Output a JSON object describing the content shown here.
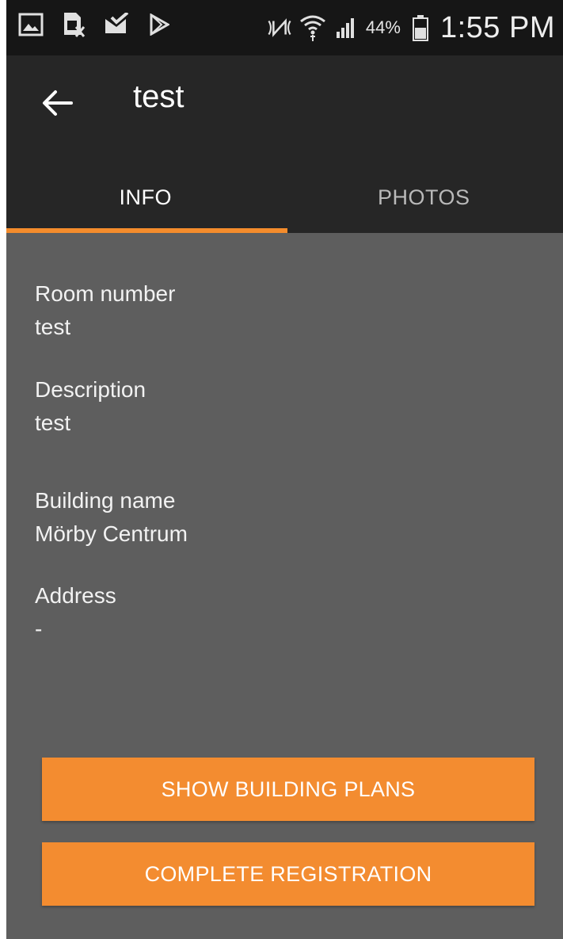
{
  "status_bar": {
    "left_icons": [
      "gallery-icon",
      "sim-card-icon",
      "check-mail-icon",
      "play-store-icon"
    ],
    "right_icons": [
      "nfc-icon",
      "wifi-icon",
      "signal-icon"
    ],
    "battery_percent": "44%",
    "time": "1:55 PM"
  },
  "app_bar": {
    "title": "test",
    "back_icon": "arrow-back-icon"
  },
  "tabs": [
    {
      "label": "INFO",
      "active": true
    },
    {
      "label": "PHOTOS",
      "active": false
    }
  ],
  "fields": [
    {
      "label": "Room number",
      "value": "test"
    },
    {
      "label": "Description",
      "value": "test"
    },
    {
      "label": "Building name",
      "value": "Mörby Centrum"
    },
    {
      "label": "Address",
      "value": "-"
    }
  ],
  "buttons": {
    "show_plans": "SHOW BUILDING PLANS",
    "complete": "COMPLETE REGISTRATION"
  },
  "colors": {
    "accent": "#f48c2c",
    "toolbar": "#262626",
    "status_bar": "#161616",
    "background": "#5e5e5e"
  }
}
